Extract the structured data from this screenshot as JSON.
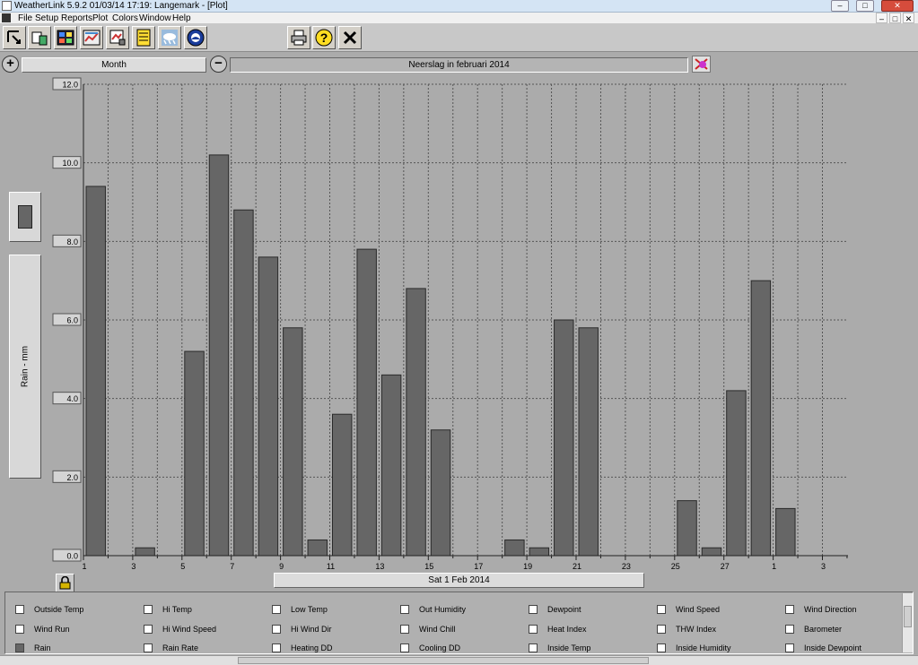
{
  "window": {
    "title": "WeatherLink 5.9.2  01/03/14  17:19: Langemark - [Plot]",
    "buttons": [
      "–",
      "□",
      "✕"
    ]
  },
  "menu": {
    "items": [
      "File",
      "Setup",
      "Reports",
      "Plot",
      "Colors",
      "Window",
      "Help"
    ],
    "mdi_buttons": [
      "–",
      "□",
      "✕"
    ]
  },
  "toolbar": {
    "icons": [
      "select-station-icon",
      "station-status-icon",
      "bulletin-icon",
      "summary-icon",
      "browse-icon",
      "notes-icon",
      "weather-icon",
      "noaa-icon",
      "print-icon",
      "help-icon",
      "close-icon"
    ],
    "glyphs": [
      "⇱",
      "☷",
      "▦",
      "▤",
      "▣",
      "☰",
      "☁",
      "◉",
      "⎙",
      "?",
      "✕"
    ]
  },
  "controls": {
    "zoom_in": "+",
    "zoom_out": "−",
    "period": "Month",
    "plot_title": "Neerslag  in februari 2014",
    "date_label": "Sat 1 Feb 2014"
  },
  "colors": {
    "bar": "#666666",
    "bar_border": "#2a2a2a",
    "grid": "#555555",
    "plot_bg": "#ababab"
  },
  "chart_data": {
    "type": "bar",
    "title": "Neerslag  in februari 2014",
    "xlabel": "Sat 1 Feb 2014",
    "ylabel": "Rain - mm",
    "ylim": [
      0,
      12
    ],
    "y_ticks": [
      "12.0",
      "10.0",
      "8.0",
      "6.0",
      "4.0",
      "2.0",
      "0.0"
    ],
    "x_ticks": [
      "1",
      "3",
      "5",
      "7",
      "9",
      "11",
      "13",
      "15",
      "17",
      "19",
      "21",
      "23",
      "25",
      "27",
      "1",
      "3"
    ],
    "grid": true,
    "categories": [
      "1",
      "2",
      "3",
      "4",
      "5",
      "6",
      "7",
      "8",
      "9",
      "10",
      "11",
      "12",
      "13",
      "14",
      "15",
      "16",
      "17",
      "18",
      "19",
      "20",
      "21",
      "22",
      "23",
      "24",
      "25",
      "26",
      "27",
      "28",
      "1",
      "2",
      "3"
    ],
    "series": [
      {
        "name": "Rain",
        "values": [
          9.4,
          0,
          0.2,
          0,
          5.2,
          10.2,
          8.8,
          7.6,
          5.8,
          0.4,
          3.6,
          7.8,
          4.6,
          6.8,
          3.2,
          0,
          0,
          0.4,
          0.2,
          6.0,
          5.8,
          0,
          0,
          0,
          1.4,
          0.2,
          4.2,
          7.0,
          1.2,
          0,
          0
        ]
      }
    ]
  },
  "legend": {
    "items": [
      {
        "label": "Outside Temp",
        "checked": false
      },
      {
        "label": "Hi Temp",
        "checked": false
      },
      {
        "label": "Low Temp",
        "checked": false
      },
      {
        "label": "Out Humidity",
        "checked": false
      },
      {
        "label": "Dewpoint",
        "checked": false
      },
      {
        "label": "Wind Speed",
        "checked": false
      },
      {
        "label": "Wind Direction",
        "checked": false
      },
      {
        "label": "Wind Run",
        "checked": false
      },
      {
        "label": "Hi Wind Speed",
        "checked": false
      },
      {
        "label": "Hi Wind Dir",
        "checked": false
      },
      {
        "label": "Wind Chill",
        "checked": false
      },
      {
        "label": "Heat Index",
        "checked": false
      },
      {
        "label": "THW Index",
        "checked": false
      },
      {
        "label": "Barometer",
        "checked": false
      },
      {
        "label": "Rain",
        "checked": true
      },
      {
        "label": "Rain Rate",
        "checked": false
      },
      {
        "label": "Heating DD",
        "checked": false
      },
      {
        "label": "Cooling DD",
        "checked": false
      },
      {
        "label": "Inside Temp",
        "checked": false
      },
      {
        "label": "Inside Humidity",
        "checked": false
      },
      {
        "label": "Inside Dewpoint",
        "checked": false
      }
    ]
  }
}
